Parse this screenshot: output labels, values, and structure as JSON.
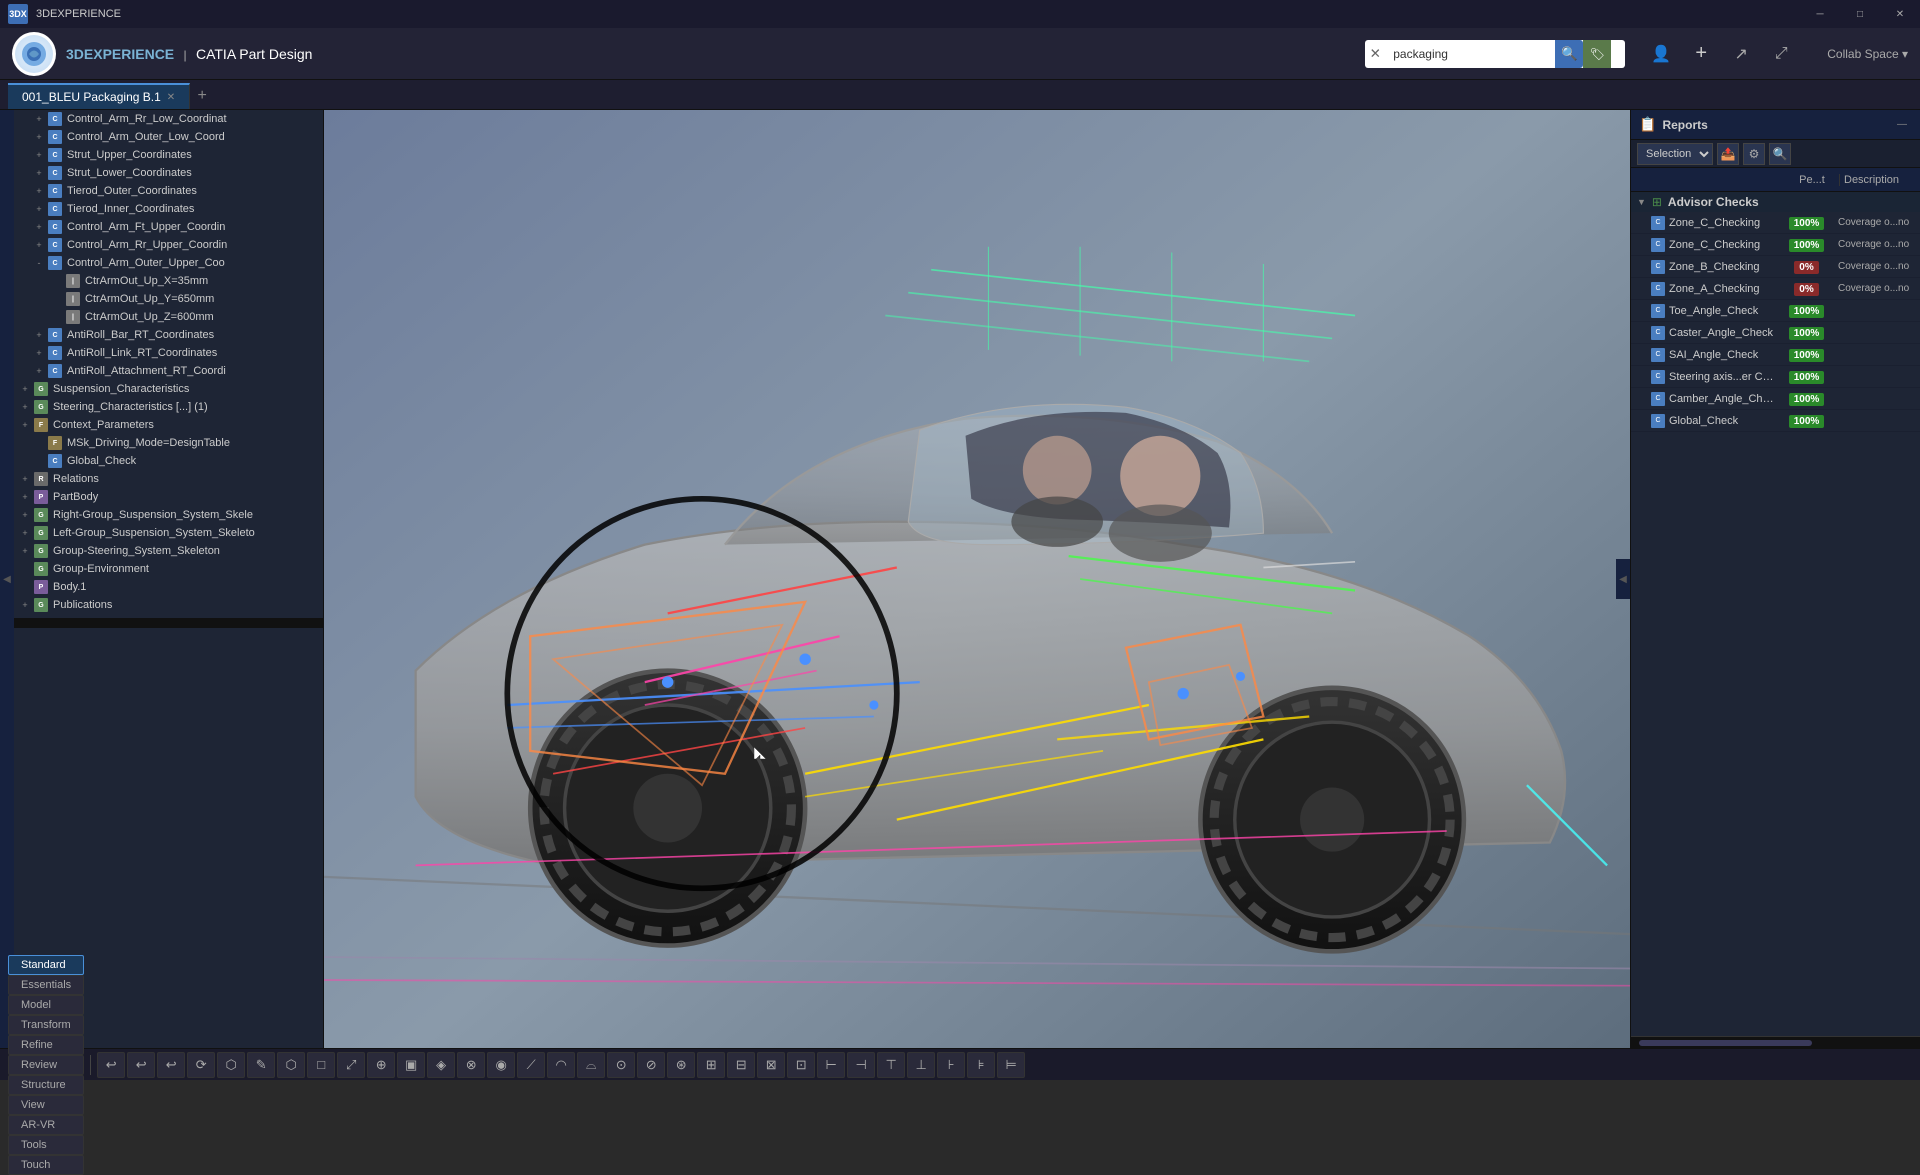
{
  "titlebar": {
    "app_name": "3DEXPERIENCE",
    "close_btn": "✕",
    "min_btn": "─",
    "max_btn": "□"
  },
  "topbar": {
    "brand": "3DEXPERIENCE",
    "product": "CATIA Part Design",
    "search_placeholder": "packaging",
    "search_value": "packaging",
    "collab_space": "Collab Space ▾"
  },
  "tab": {
    "label": "001_BLEU Packaging B.1",
    "add_label": "+"
  },
  "tree": {
    "items": [
      {
        "id": "control-arm-rr-low",
        "label": "Control_Arm_Rr_Low_Coordinat",
        "icon": "coord",
        "indent": 1,
        "expand": "+"
      },
      {
        "id": "control-arm-outer-low",
        "label": "Control_Arm_Outer_Low_Coord",
        "icon": "coord",
        "indent": 1,
        "expand": "+"
      },
      {
        "id": "strut-upper",
        "label": "Strut_Upper_Coordinates",
        "icon": "coord",
        "indent": 1,
        "expand": "+"
      },
      {
        "id": "strut-lower",
        "label": "Strut_Lower_Coordinates",
        "icon": "coord",
        "indent": 1,
        "expand": "+"
      },
      {
        "id": "tierod-outer",
        "label": "Tierod_Outer_Coordinates",
        "icon": "coord",
        "indent": 1,
        "expand": "+"
      },
      {
        "id": "tierod-inner",
        "label": "Tierod_Inner_Coordinates",
        "icon": "coord",
        "indent": 1,
        "expand": "+"
      },
      {
        "id": "control-arm-ft-upper",
        "label": "Control_Arm_Ft_Upper_Coordin",
        "icon": "coord",
        "indent": 1,
        "expand": "+"
      },
      {
        "id": "control-arm-rr-upper",
        "label": "Control_Arm_Rr_Upper_Coordin",
        "icon": "coord",
        "indent": 1,
        "expand": "+"
      },
      {
        "id": "control-arm-outer-upper",
        "label": "Control_Arm_Outer_Upper_Coo",
        "icon": "coord",
        "indent": 1,
        "expand": "-"
      },
      {
        "id": "ctrarmout-x",
        "label": "CtrArmOut_Up_X=35mm",
        "icon": "measure",
        "indent": 2,
        "expand": ""
      },
      {
        "id": "ctrarmout-y",
        "label": "CtrArmOut_Up_Y=650mm",
        "icon": "measure",
        "indent": 2,
        "expand": ""
      },
      {
        "id": "ctrarmout-z",
        "label": "CtrArmOut_Up_Z=600mm",
        "icon": "measure",
        "indent": 2,
        "expand": ""
      },
      {
        "id": "antiroll-bar",
        "label": "AntiRoll_Bar_RT_Coordinates",
        "icon": "coord",
        "indent": 1,
        "expand": "+"
      },
      {
        "id": "antiroll-link",
        "label": "AntiRoll_Link_RT_Coordinates",
        "icon": "coord",
        "indent": 1,
        "expand": "+"
      },
      {
        "id": "antiroll-attach",
        "label": "AntiRoll_Attachment_RT_Coordi",
        "icon": "coord",
        "indent": 1,
        "expand": "+"
      },
      {
        "id": "suspension-char",
        "label": "Suspension_Characteristics",
        "icon": "group",
        "indent": 0,
        "expand": "+"
      },
      {
        "id": "steering-char",
        "label": "Steering_Characteristics [...] (1)",
        "icon": "group",
        "indent": 0,
        "expand": "+"
      },
      {
        "id": "context-params",
        "label": "Context_Parameters",
        "icon": "param",
        "indent": 0,
        "expand": "+"
      },
      {
        "id": "msk-driving",
        "label": "MSk_Driving_Mode=DesignTable",
        "icon": "param",
        "indent": 1,
        "expand": ""
      },
      {
        "id": "global-check",
        "label": "Global_Check",
        "icon": "coord",
        "indent": 1,
        "expand": ""
      },
      {
        "id": "relations",
        "label": "Relations",
        "icon": "relations",
        "indent": 0,
        "expand": "+"
      },
      {
        "id": "partbody",
        "label": "PartBody",
        "icon": "part",
        "indent": 0,
        "expand": "+"
      },
      {
        "id": "right-group",
        "label": "Right-Group_Suspension_System_Skele",
        "icon": "group",
        "indent": 0,
        "expand": "+"
      },
      {
        "id": "left-group",
        "label": "Left-Group_Suspension_System_Skeleto",
        "icon": "group",
        "indent": 0,
        "expand": "+"
      },
      {
        "id": "group-steering",
        "label": "Group-Steering_System_Skeleton",
        "icon": "group",
        "indent": 0,
        "expand": "+"
      },
      {
        "id": "group-environment",
        "label": "Group-Environment",
        "icon": "group",
        "indent": 0,
        "expand": ""
      },
      {
        "id": "body-1",
        "label": "Body.1",
        "icon": "part",
        "indent": 0,
        "expand": ""
      },
      {
        "id": "publications",
        "label": "Publications",
        "icon": "group",
        "indent": 0,
        "expand": "+"
      }
    ]
  },
  "reports": {
    "title": "Reports",
    "dropdown": "Selection",
    "col_pct": "Pe...t",
    "col_desc": "Description",
    "section": "Advisor Checks",
    "rows": [
      {
        "name": "Zone_C_Checking",
        "pct": "100%",
        "pct_type": "green",
        "desc": "Coverage o...no"
      },
      {
        "name": "Zone_C_Checking",
        "pct": "100%",
        "pct_type": "green",
        "desc": "Coverage o...no"
      },
      {
        "name": "Zone_B_Checking",
        "pct": "0%",
        "pct_type": "red",
        "desc": "Coverage o...no"
      },
      {
        "name": "Zone_A_Checking",
        "pct": "0%",
        "pct_type": "red",
        "desc": "Coverage o...no"
      },
      {
        "name": "Toe_Angle_Check",
        "pct": "100%",
        "pct_type": "green",
        "desc": ""
      },
      {
        "name": "Caster_Angle_Check",
        "pct": "100%",
        "pct_type": "green",
        "desc": ""
      },
      {
        "name": "SAI_Angle_Check",
        "pct": "100%",
        "pct_type": "green",
        "desc": ""
      },
      {
        "name": "Steering axis...er Control_Arm",
        "pct": "100%",
        "pct_type": "green",
        "desc": ""
      },
      {
        "name": "Camber_Angle_Check",
        "pct": "100%",
        "pct_type": "green",
        "desc": ""
      },
      {
        "name": "Global_Check",
        "pct": "100%",
        "pct_type": "green",
        "desc": ""
      }
    ]
  },
  "bottom_tabs": [
    {
      "label": "Standard",
      "active": true
    },
    {
      "label": "Essentials",
      "active": false
    },
    {
      "label": "Model",
      "active": false
    },
    {
      "label": "Transform",
      "active": false
    },
    {
      "label": "Refine",
      "active": false
    },
    {
      "label": "Review",
      "active": false
    },
    {
      "label": "Structure",
      "active": false
    },
    {
      "label": "View",
      "active": false
    },
    {
      "label": "AR-VR",
      "active": false
    },
    {
      "label": "Tools",
      "active": false
    },
    {
      "label": "Touch",
      "active": false
    }
  ],
  "toolbar_icons": [
    "↩",
    "↩",
    "▣",
    "⟳",
    "✦",
    "✎",
    "⬡",
    "□",
    "⤢",
    "⊕",
    "▣",
    "◈",
    "⊗",
    "◉",
    "⟋",
    "◠",
    "⌓",
    "⊙",
    "⊘",
    "⊛",
    "⊞",
    "⊟",
    "⊠",
    "⊡",
    "⊢",
    "⊣",
    "⊤",
    "⊥",
    "⊦",
    "⊧",
    "⊨"
  ],
  "icons": {
    "expand": "▶",
    "collapse": "▼",
    "reports_icon": "📊",
    "folder_icon": "📁",
    "part_icon": "⬡",
    "coord_icon": "✛",
    "measure_icon": "|",
    "arrow_left": "◀",
    "arrow_right": "▶"
  }
}
